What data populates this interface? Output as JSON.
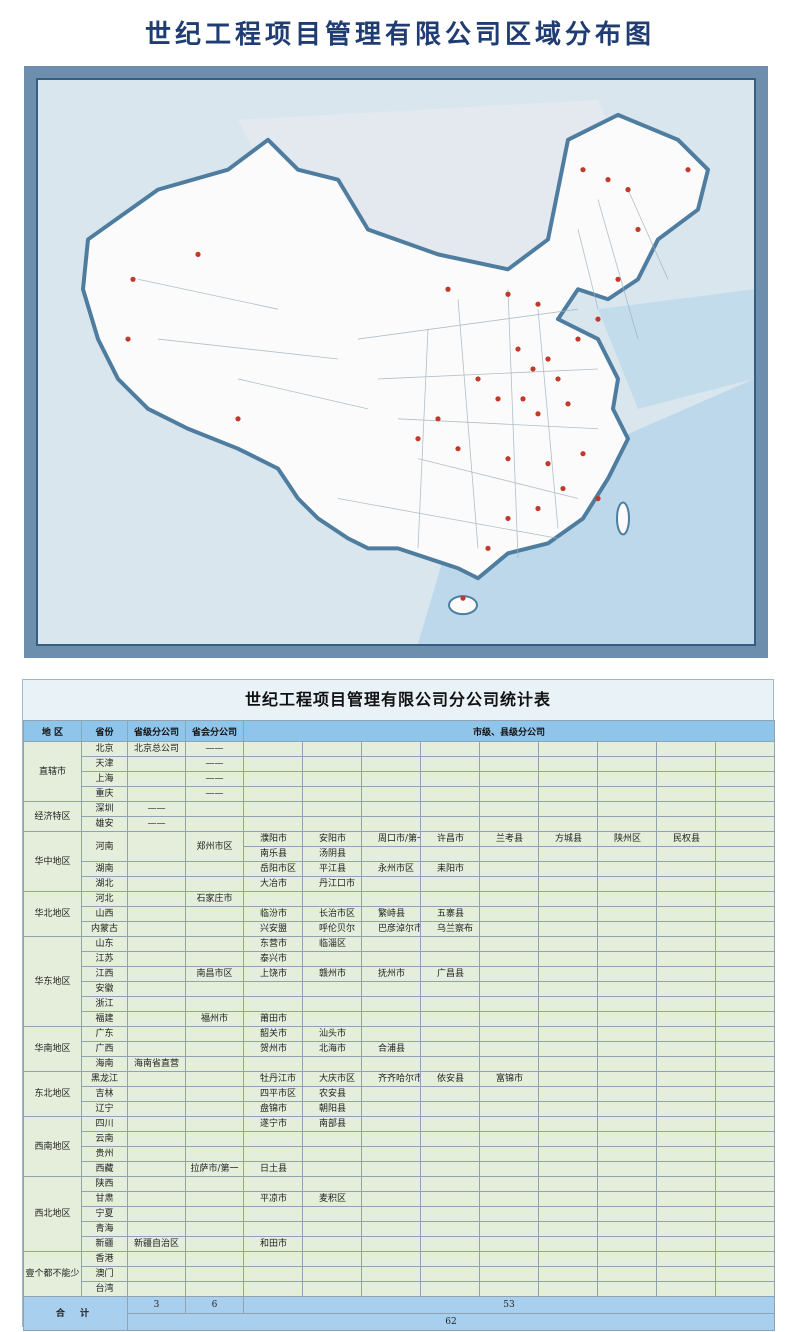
{
  "page_title": "世纪工程项目管理有限公司区域分布图",
  "table_title": "世纪工程项目管理有限公司分公司统计表",
  "headers": {
    "region": "地  区",
    "province": "省份",
    "prov_branch": "省级分公司",
    "capital_branch": "省会分公司",
    "city_branch": "市级、县级分公司"
  },
  "groups": [
    {
      "region": "直辖市",
      "rows": [
        {
          "p": "北京",
          "a": "北京总公司",
          "b": "——",
          "c": []
        },
        {
          "p": "天津",
          "a": "",
          "b": "——",
          "c": []
        },
        {
          "p": "上海",
          "a": "",
          "b": "——",
          "c": []
        },
        {
          "p": "重庆",
          "a": "",
          "b": "——",
          "c": []
        }
      ]
    },
    {
      "region": "经济特区",
      "rows": [
        {
          "p": "深圳",
          "a": "——",
          "b": "",
          "c": []
        },
        {
          "p": "雄安",
          "a": "——",
          "b": "",
          "c": []
        }
      ]
    },
    {
      "region": "华中地区",
      "rows": [
        {
          "p": "河南",
          "a": "",
          "b": "郑州市区",
          "c": [
            "濮阳市",
            "安阳市",
            "周口市/第一",
            "许昌市",
            "兰考县",
            "方城县",
            "陕州区",
            "民权县"
          ],
          "c2": [
            "南乐县",
            "汤阴县"
          ]
        },
        {
          "p": "湖南",
          "a": "",
          "b": "",
          "c": [
            "岳阳市区",
            "平江县",
            "永州市区",
            "耒阳市"
          ]
        },
        {
          "p": "湖北",
          "a": "",
          "b": "",
          "c": [
            "大冶市",
            "丹江口市"
          ]
        }
      ]
    },
    {
      "region": "华北地区",
      "rows": [
        {
          "p": "河北",
          "a": "",
          "b": "石家庄市",
          "c": []
        },
        {
          "p": "山西",
          "a": "",
          "b": "",
          "c": [
            "临汾市",
            "长治市区",
            "繁峙县",
            "五寨县"
          ]
        },
        {
          "p": "内蒙古",
          "a": "",
          "b": "",
          "c": [
            "兴安盟",
            "呼伦贝尔",
            "巴彦淖尔市区",
            "乌兰察布"
          ]
        }
      ]
    },
    {
      "region": "华东地区",
      "rows": [
        {
          "p": "山东",
          "a": "",
          "b": "",
          "c": [
            "东营市",
            "临淄区"
          ]
        },
        {
          "p": "江苏",
          "a": "",
          "b": "",
          "c": [
            "泰兴市"
          ]
        },
        {
          "p": "江西",
          "a": "",
          "b": "南昌市区",
          "c": [
            "上饶市",
            "赣州市",
            "抚州市",
            "广昌县"
          ]
        },
        {
          "p": "安徽",
          "a": "",
          "b": "",
          "c": []
        },
        {
          "p": "浙江",
          "a": "",
          "b": "",
          "c": []
        },
        {
          "p": "福建",
          "a": "",
          "b": "福州市",
          "c": [
            "莆田市"
          ]
        }
      ]
    },
    {
      "region": "华南地区",
      "rows": [
        {
          "p": "广东",
          "a": "",
          "b": "",
          "c": [
            "韶关市",
            "汕头市"
          ]
        },
        {
          "p": "广西",
          "a": "",
          "b": "",
          "c": [
            "贺州市",
            "北海市",
            "合浦县"
          ]
        },
        {
          "p": "海南",
          "a": "海南省直营",
          "b": "",
          "c": []
        }
      ]
    },
    {
      "region": "东北地区",
      "rows": [
        {
          "p": "黑龙江",
          "a": "",
          "b": "",
          "c": [
            "牡丹江市",
            "大庆市区",
            "齐齐哈尔市区",
            "依安县",
            "富锦市"
          ]
        },
        {
          "p": "吉林",
          "a": "",
          "b": "",
          "c": [
            "四平市区",
            "农安县"
          ]
        },
        {
          "p": "辽宁",
          "a": "",
          "b": "",
          "c": [
            "盘锦市",
            "朝阳县"
          ]
        }
      ]
    },
    {
      "region": "西南地区",
      "rows": [
        {
          "p": "四川",
          "a": "",
          "b": "",
          "c": [
            "遂宁市",
            "南部县"
          ]
        },
        {
          "p": "云南",
          "a": "",
          "b": "",
          "c": []
        },
        {
          "p": "贵州",
          "a": "",
          "b": "",
          "c": []
        },
        {
          "p": "西藏",
          "a": "",
          "b": "拉萨市/第一",
          "c": [
            "日土县"
          ]
        }
      ]
    },
    {
      "region": "西北地区",
      "rows": [
        {
          "p": "陕西",
          "a": "",
          "b": "",
          "c": []
        },
        {
          "p": "甘肃",
          "a": "",
          "b": "",
          "c": [
            "平凉市",
            "麦积区"
          ]
        },
        {
          "p": "宁夏",
          "a": "",
          "b": "",
          "c": []
        },
        {
          "p": "青海",
          "a": "",
          "b": "",
          "c": []
        },
        {
          "p": "新疆",
          "a": "新疆自治区",
          "b": "",
          "c": [
            "和田市"
          ]
        }
      ]
    },
    {
      "region": "壹个都不能少",
      "rows": [
        {
          "p": "香港",
          "a": "",
          "b": "",
          "c": []
        },
        {
          "p": "澳门",
          "a": "",
          "b": "",
          "c": []
        },
        {
          "p": "台湾",
          "a": "",
          "b": "",
          "c": []
        }
      ]
    }
  ],
  "totals": {
    "label": "合  计",
    "prov": "3",
    "capital": "6",
    "city": "53",
    "grand": "62"
  }
}
